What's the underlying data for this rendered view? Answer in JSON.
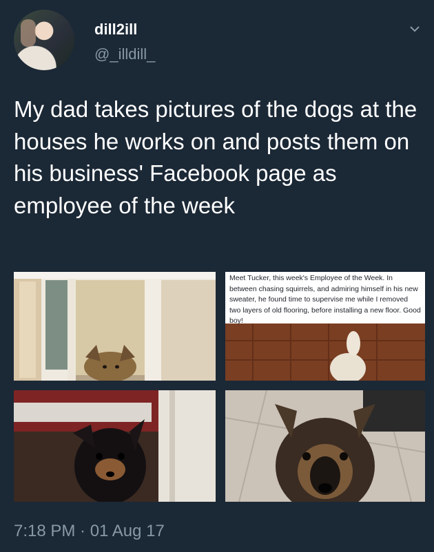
{
  "user": {
    "display_name": "dill2ill",
    "handle": "@_illdill_"
  },
  "tweet": {
    "text": "My dad takes pictures of the dogs at the houses he works on and posts them on his business' Facebook page as employee of the week",
    "timestamp": "7:18 PM · 01 Aug 17"
  },
  "media": {
    "caption": "Meet Tucker, this week's Employee of the Week. In between chasing squirrels, and admiring himself in his new sweater, he found time to supervise me while I removed two layers of old flooring, before installing a new floor. Good boy!"
  },
  "icons": {
    "menu": "chevron-down-icon"
  },
  "colors": {
    "background": "#1b2836",
    "text_primary": "#ffffff",
    "text_secondary": "#8899a6"
  }
}
